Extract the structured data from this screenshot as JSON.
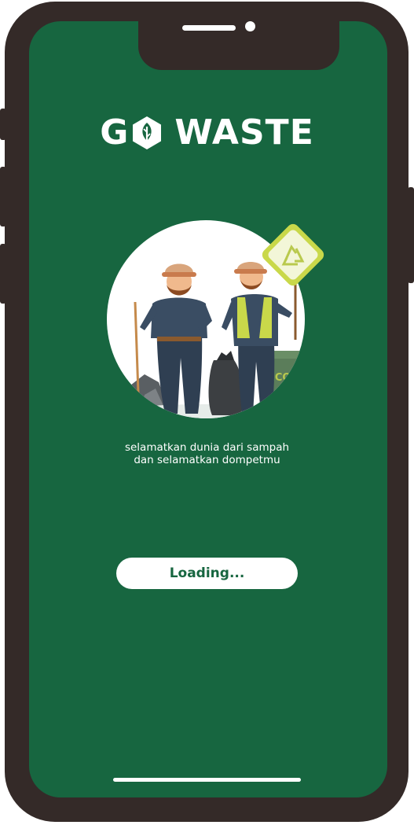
{
  "app": {
    "logo_left": "G",
    "logo_right": "WASTE",
    "logo_icon": "leaf-hexagon-icon"
  },
  "tagline": {
    "line1": "selamatkan dunia dari sampah",
    "line2": "dan selamatkan dompetmu"
  },
  "loading_button": {
    "label": "Loading..."
  },
  "illustration": {
    "sign_icon": "recycle-icon",
    "bin_label": "ECO"
  },
  "colors": {
    "screen_bg": "#176640",
    "frame": "#342a28",
    "accent": "#b9c94d"
  }
}
